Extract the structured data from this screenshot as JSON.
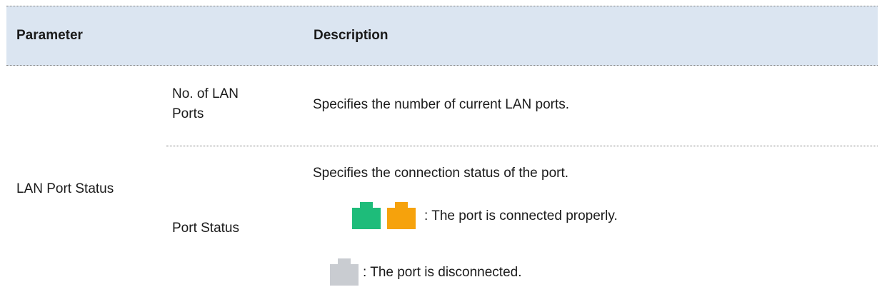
{
  "table": {
    "headers": {
      "parameter": "Parameter",
      "description": "Description"
    },
    "group_label": "LAN Port Status",
    "rows": [
      {
        "name_line1": "No. of LAN",
        "name_line2": "Ports",
        "description": "Specifies the number of current LAN ports."
      },
      {
        "name": "Port Status",
        "description": "Specifies the connection status of the port.",
        "connected_text": ": The port is connected properly.",
        "disconnected_text": ": The port is disconnected."
      }
    ]
  },
  "icons": {
    "connected": [
      {
        "name": "port-connected-green-icon",
        "color": "#1ebc7a"
      },
      {
        "name": "port-connected-orange-icon",
        "color": "#f6a20c"
      }
    ],
    "disconnected": {
      "name": "port-disconnected-gray-icon",
      "color": "#c9ccd1"
    }
  }
}
